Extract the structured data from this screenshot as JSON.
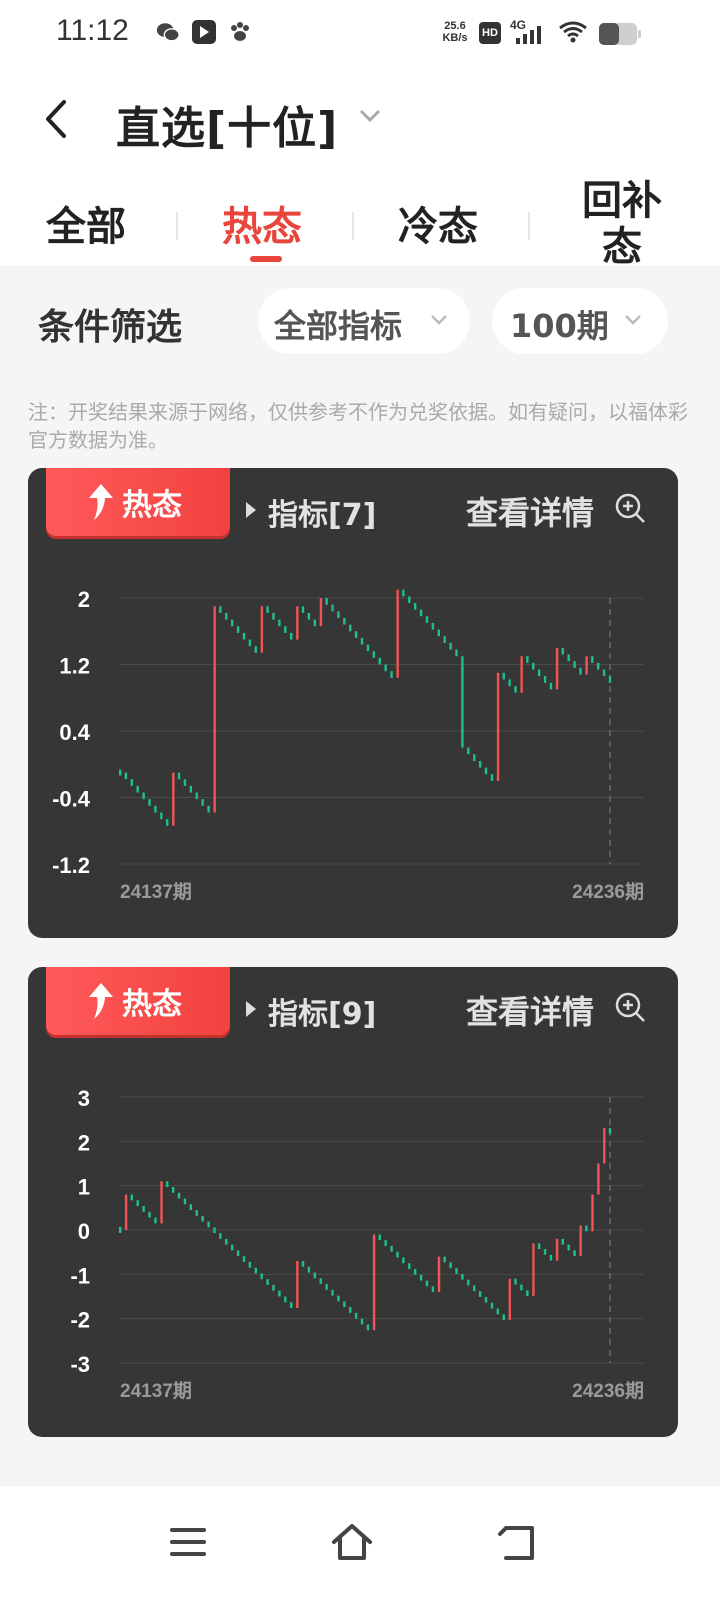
{
  "status_bar": {
    "time": "11:12",
    "net_speed_value": "25.6",
    "net_speed_unit": "KB/s",
    "hd": "HD",
    "network": "4G"
  },
  "header": {
    "title": "直选[十位]"
  },
  "tabs": [
    {
      "label": "全部",
      "active": false
    },
    {
      "label": "热态",
      "active": true
    },
    {
      "label": "冷态",
      "active": false
    },
    {
      "label": "回补态",
      "active": false
    }
  ],
  "filter": {
    "label": "条件筛选",
    "indicator_select": "全部指标",
    "period_select": "100期"
  },
  "notice": "注：开奖结果来源于网络，仅供参考不作为兑奖依据。如有疑问，以福体彩官方数据为准。",
  "colors": {
    "accent": "#e8453c",
    "card_bg": "#363636",
    "up": "#f05454",
    "down": "#1fbf8f"
  },
  "cards": [
    {
      "badge": "热态",
      "indicator": "指标[7]",
      "detail": "查看详情",
      "chart_data": {
        "type": "line",
        "y_ticks": [
          "2",
          "1.2",
          "0.4",
          "-0.4",
          "-1.2"
        ],
        "ylim": [
          -1.2,
          2
        ],
        "x_start_label": "24137期",
        "x_end_label": "24236期",
        "step": 0.08,
        "start": -0.1,
        "jumps": [
          [
            9,
            -1.0,
            0.9
          ],
          [
            16,
            0.9,
            1.0
          ],
          [
            24,
            0.9,
            1.0
          ],
          [
            30,
            0.8,
            1.1
          ],
          [
            34,
            0.9,
            1.1
          ],
          [
            47,
            1.0,
            1.1
          ],
          [
            58,
            -0.8,
            1.0
          ],
          [
            64,
            0.1,
            1.0
          ],
          [
            68,
            0.3,
            1.0
          ],
          [
            74,
            0.5,
            0.9
          ],
          [
            79,
            0.3,
            1.0
          ]
        ]
      }
    },
    {
      "badge": "热态",
      "indicator": "指标[9]",
      "detail": "查看详情",
      "chart_data": {
        "type": "line",
        "y_ticks": [
          "3",
          "2",
          "1",
          "0",
          "-1",
          "-2",
          "-3"
        ],
        "ylim": [
          -3,
          3
        ],
        "x_start_label": "24137期",
        "x_end_label": "24236期",
        "step": 0.13,
        "start": 0,
        "jumps": [
          [
            1,
            0.0,
            0.8
          ],
          [
            7,
            0.1,
            1.0
          ],
          [
            30,
            -1.6,
            0.9
          ],
          [
            43,
            -1.1,
            1.0
          ],
          [
            54,
            -1.6,
            1.0
          ],
          [
            66,
            -2.1,
            1.0
          ],
          [
            70,
            -1.2,
            0.9
          ],
          [
            74,
            -0.9,
            0.7
          ],
          [
            78,
            -0.7,
            0.8
          ],
          [
            80,
            -0.2,
            1.0
          ],
          [
            81,
            0.7,
            0.8
          ],
          [
            82,
            1.4,
            0.9
          ]
        ]
      }
    }
  ]
}
